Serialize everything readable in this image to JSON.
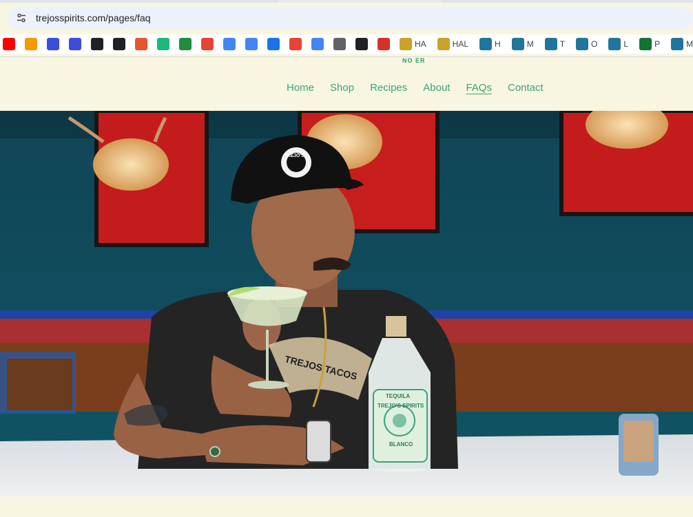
{
  "browser": {
    "url": "trejosspirits.com/pages/faq",
    "bookmarks": [
      {
        "icon": "youtube-icon",
        "label": "",
        "color": "#ff0000"
      },
      {
        "icon": "flame-icon",
        "label": "",
        "color": "#f29900"
      },
      {
        "icon": "q-icon",
        "label": "",
        "color": "#3c4cdb"
      },
      {
        "icon": "q-icon",
        "label": "",
        "color": "#3c4cdb"
      },
      {
        "icon": "openai-icon",
        "label": "",
        "color": "#202124"
      },
      {
        "icon": "k-icon",
        "label": "",
        "color": "#202124"
      },
      {
        "icon": "t-icon",
        "label": "",
        "color": "#e8542d"
      },
      {
        "icon": "t-circle-icon",
        "label": "",
        "color": "#1fb87a"
      },
      {
        "icon": "drive-icon",
        "label": "",
        "color": "#1e8e3e"
      },
      {
        "icon": "maps-icon",
        "label": "",
        "color": "#ea4335"
      },
      {
        "icon": "sparkle-icon",
        "label": "",
        "color": "#4285f4"
      },
      {
        "icon": "gs-icon",
        "label": "",
        "color": "#4285f4"
      },
      {
        "icon": "calendar-icon",
        "label": "",
        "color": "#1a73e8"
      },
      {
        "icon": "gmail-icon",
        "label": "",
        "color": "#ea4335"
      },
      {
        "icon": "translate-icon",
        "label": "",
        "color": "#4285f4"
      },
      {
        "icon": "translate-alt-icon",
        "label": "",
        "color": "#5f6368"
      },
      {
        "icon": "tuning-fork-icon",
        "label": "",
        "color": "#202124"
      },
      {
        "icon": "cube-icon",
        "label": "",
        "color": "#d93025"
      },
      {
        "icon": "h-icon",
        "label": "HA",
        "color": "#c9a227"
      },
      {
        "icon": "h-icon",
        "label": "HAL",
        "color": "#c9a227"
      },
      {
        "icon": "wordpress-icon",
        "label": "H",
        "color": "#21759b"
      },
      {
        "icon": "wordpress-icon",
        "label": "M",
        "color": "#21759b"
      },
      {
        "icon": "wordpress-icon",
        "label": "T",
        "color": "#21759b"
      },
      {
        "icon": "wordpress-icon",
        "label": "O",
        "color": "#21759b"
      },
      {
        "icon": "wordpress-icon",
        "label": "L",
        "color": "#21759b"
      },
      {
        "icon": "green-square-icon",
        "label": "P",
        "color": "#137333"
      },
      {
        "icon": "wordpress-icon",
        "label": "MI",
        "color": "#21759b"
      }
    ]
  },
  "site": {
    "logo_fragment": "NO ER",
    "nav": [
      {
        "label": "Home",
        "active": false
      },
      {
        "label": "Shop",
        "active": false
      },
      {
        "label": "Recipes",
        "active": false
      },
      {
        "label": "About",
        "active": false
      },
      {
        "label": "FAQs",
        "active": true
      },
      {
        "label": "Contact",
        "active": false
      }
    ],
    "accent": "#3aa37a",
    "background": "#f8f6e1"
  },
  "hero": {
    "cap_badge": "TREJO'S",
    "bottle_label_top": "TEQUILA",
    "bottle_label_main": "TREJO'S SPIRITS",
    "bottle_label_sub": "BLANCO",
    "shirt_text": "TREJOS TACOS"
  }
}
